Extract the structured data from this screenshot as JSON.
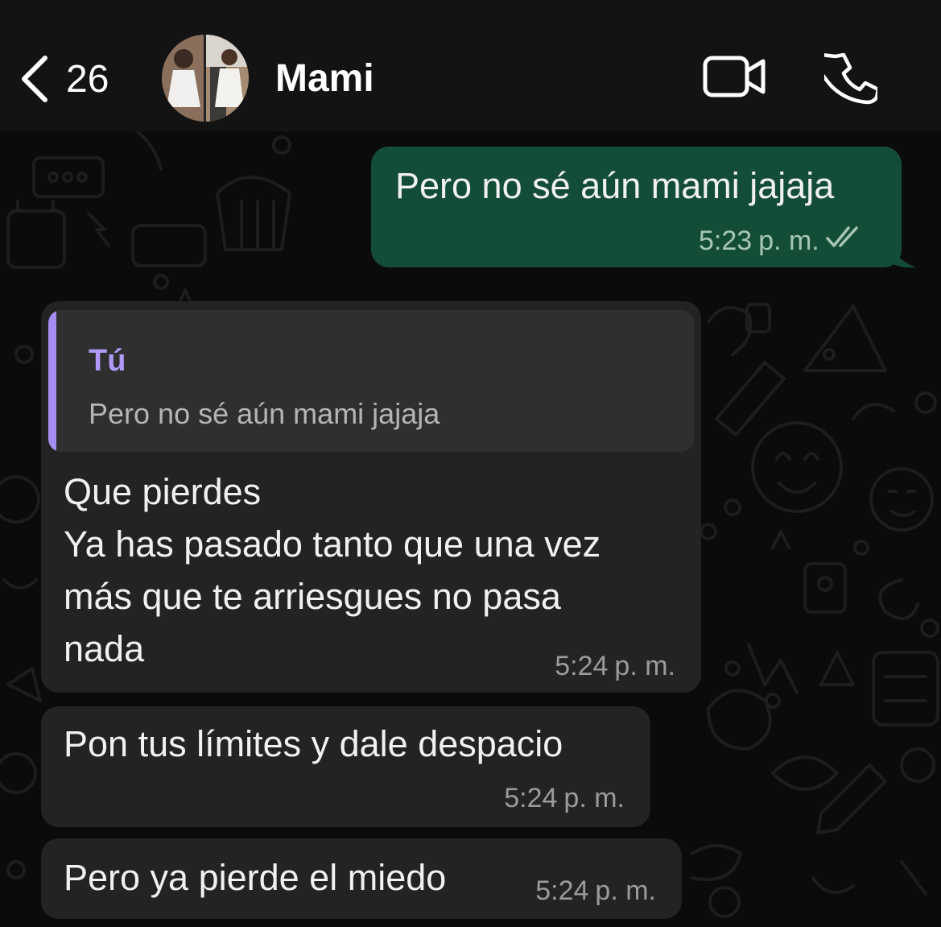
{
  "header": {
    "back_count": "26",
    "contact_name": "Mami",
    "icons": [
      "chevron-left-icon",
      "video-camera-icon",
      "phone-icon"
    ]
  },
  "colors": {
    "header_bg": "#131313",
    "chat_bg": "#0b0b0b",
    "outgoing_bubble": "#144d37",
    "incoming_bubble": "#222322",
    "quote_accent": "#a58cf0"
  },
  "messages": [
    {
      "direction": "outgoing",
      "text": "Pero no sé aún mami jajaja",
      "time": "5:23",
      "ampm": "p. m.",
      "status": "read"
    },
    {
      "direction": "incoming",
      "quote": {
        "author": "Tú",
        "text": "Pero no sé aún mami jajaja"
      },
      "text": "Que pierdes\nYa has pasado tanto que una vez\nmás que te arriesgues no pasa\nnada",
      "time": "5:24",
      "ampm": "p. m."
    },
    {
      "direction": "incoming",
      "text": "Pon tus límites y dale despacio",
      "time": "5:24",
      "ampm": "p. m."
    },
    {
      "direction": "incoming",
      "text": "Pero ya pierde el miedo",
      "time": "5:24",
      "ampm": "p. m."
    }
  ]
}
